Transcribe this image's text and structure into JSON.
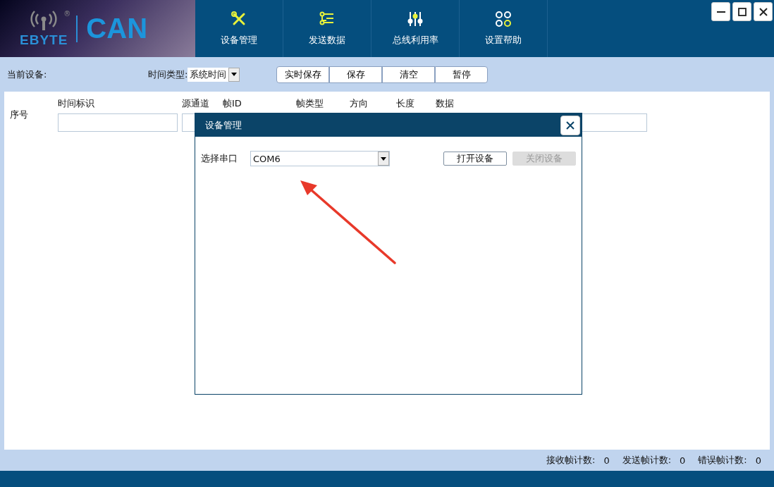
{
  "logo": {
    "brand": "EBYTE",
    "mark": "®",
    "product": "CAN"
  },
  "nav": [
    {
      "label": "设备管理",
      "kind": "tools"
    },
    {
      "label": "发送数据",
      "kind": "list"
    },
    {
      "label": "总线利用率",
      "kind": "sliders"
    },
    {
      "label": "设置帮助",
      "kind": "circles"
    }
  ],
  "toolbar": {
    "device_label": "当前设备:",
    "time_type_label": "时间类型:",
    "time_type_value": "系统时间",
    "buttons": [
      "实时保存",
      "保存",
      "清空",
      "暂停"
    ]
  },
  "table": {
    "index_column": "序号",
    "columns": [
      "时间标识",
      "源通道",
      "帧ID",
      "帧类型",
      "方向",
      "长度",
      "数据"
    ]
  },
  "dialog": {
    "title": "设备管理",
    "port_label": "选择串口",
    "port_value": "COM6",
    "buttons": [
      {
        "label": "打开设备",
        "disabled": false
      },
      {
        "label": "关闭设备",
        "disabled": true
      }
    ]
  },
  "status_bar": [
    {
      "label": "接收帧计数:",
      "value": "0"
    },
    {
      "label": "发送帧计数:",
      "value": "0"
    },
    {
      "label": "错误帧计数:",
      "value": "0"
    }
  ]
}
